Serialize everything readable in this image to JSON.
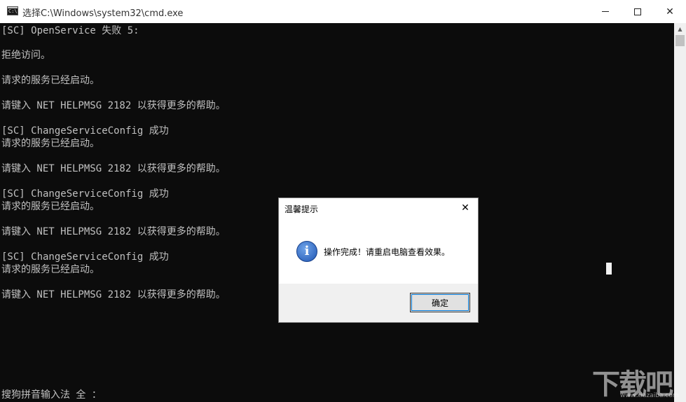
{
  "window": {
    "title": "选择C:\\Windows\\system32\\cmd.exe",
    "icon": "cmd-icon",
    "controls": {
      "minimize": "minimize",
      "maximize": "maximize",
      "close": "close"
    }
  },
  "console": {
    "lines": [
      "[SC] OpenService 失败 5:",
      "拒绝访问。",
      "请求的服务已经启动。",
      "请键入 NET HELPMSG 2182 以获得更多的帮助。",
      "[SC] ChangeServiceConfig 成功",
      "请求的服务已经启动。",
      "请键入 NET HELPMSG 2182 以获得更多的帮助。",
      "[SC] ChangeServiceConfig 成功",
      "请求的服务已经启动。",
      "请键入 NET HELPMSG 2182 以获得更多的帮助。",
      "[SC] ChangeServiceConfig 成功",
      "请求的服务已经启动。",
      "请键入 NET HELPMSG 2182 以获得更多的帮助。"
    ],
    "ime_status": "搜狗拼音输入法 全 ："
  },
  "dialog": {
    "title": "温馨提示",
    "message": "操作完成！请重启电脑查看效果。",
    "icon": "info-icon",
    "ok_label": "确定"
  },
  "watermark": {
    "text": "下载吧",
    "url": "www.xiazaiba.com"
  }
}
